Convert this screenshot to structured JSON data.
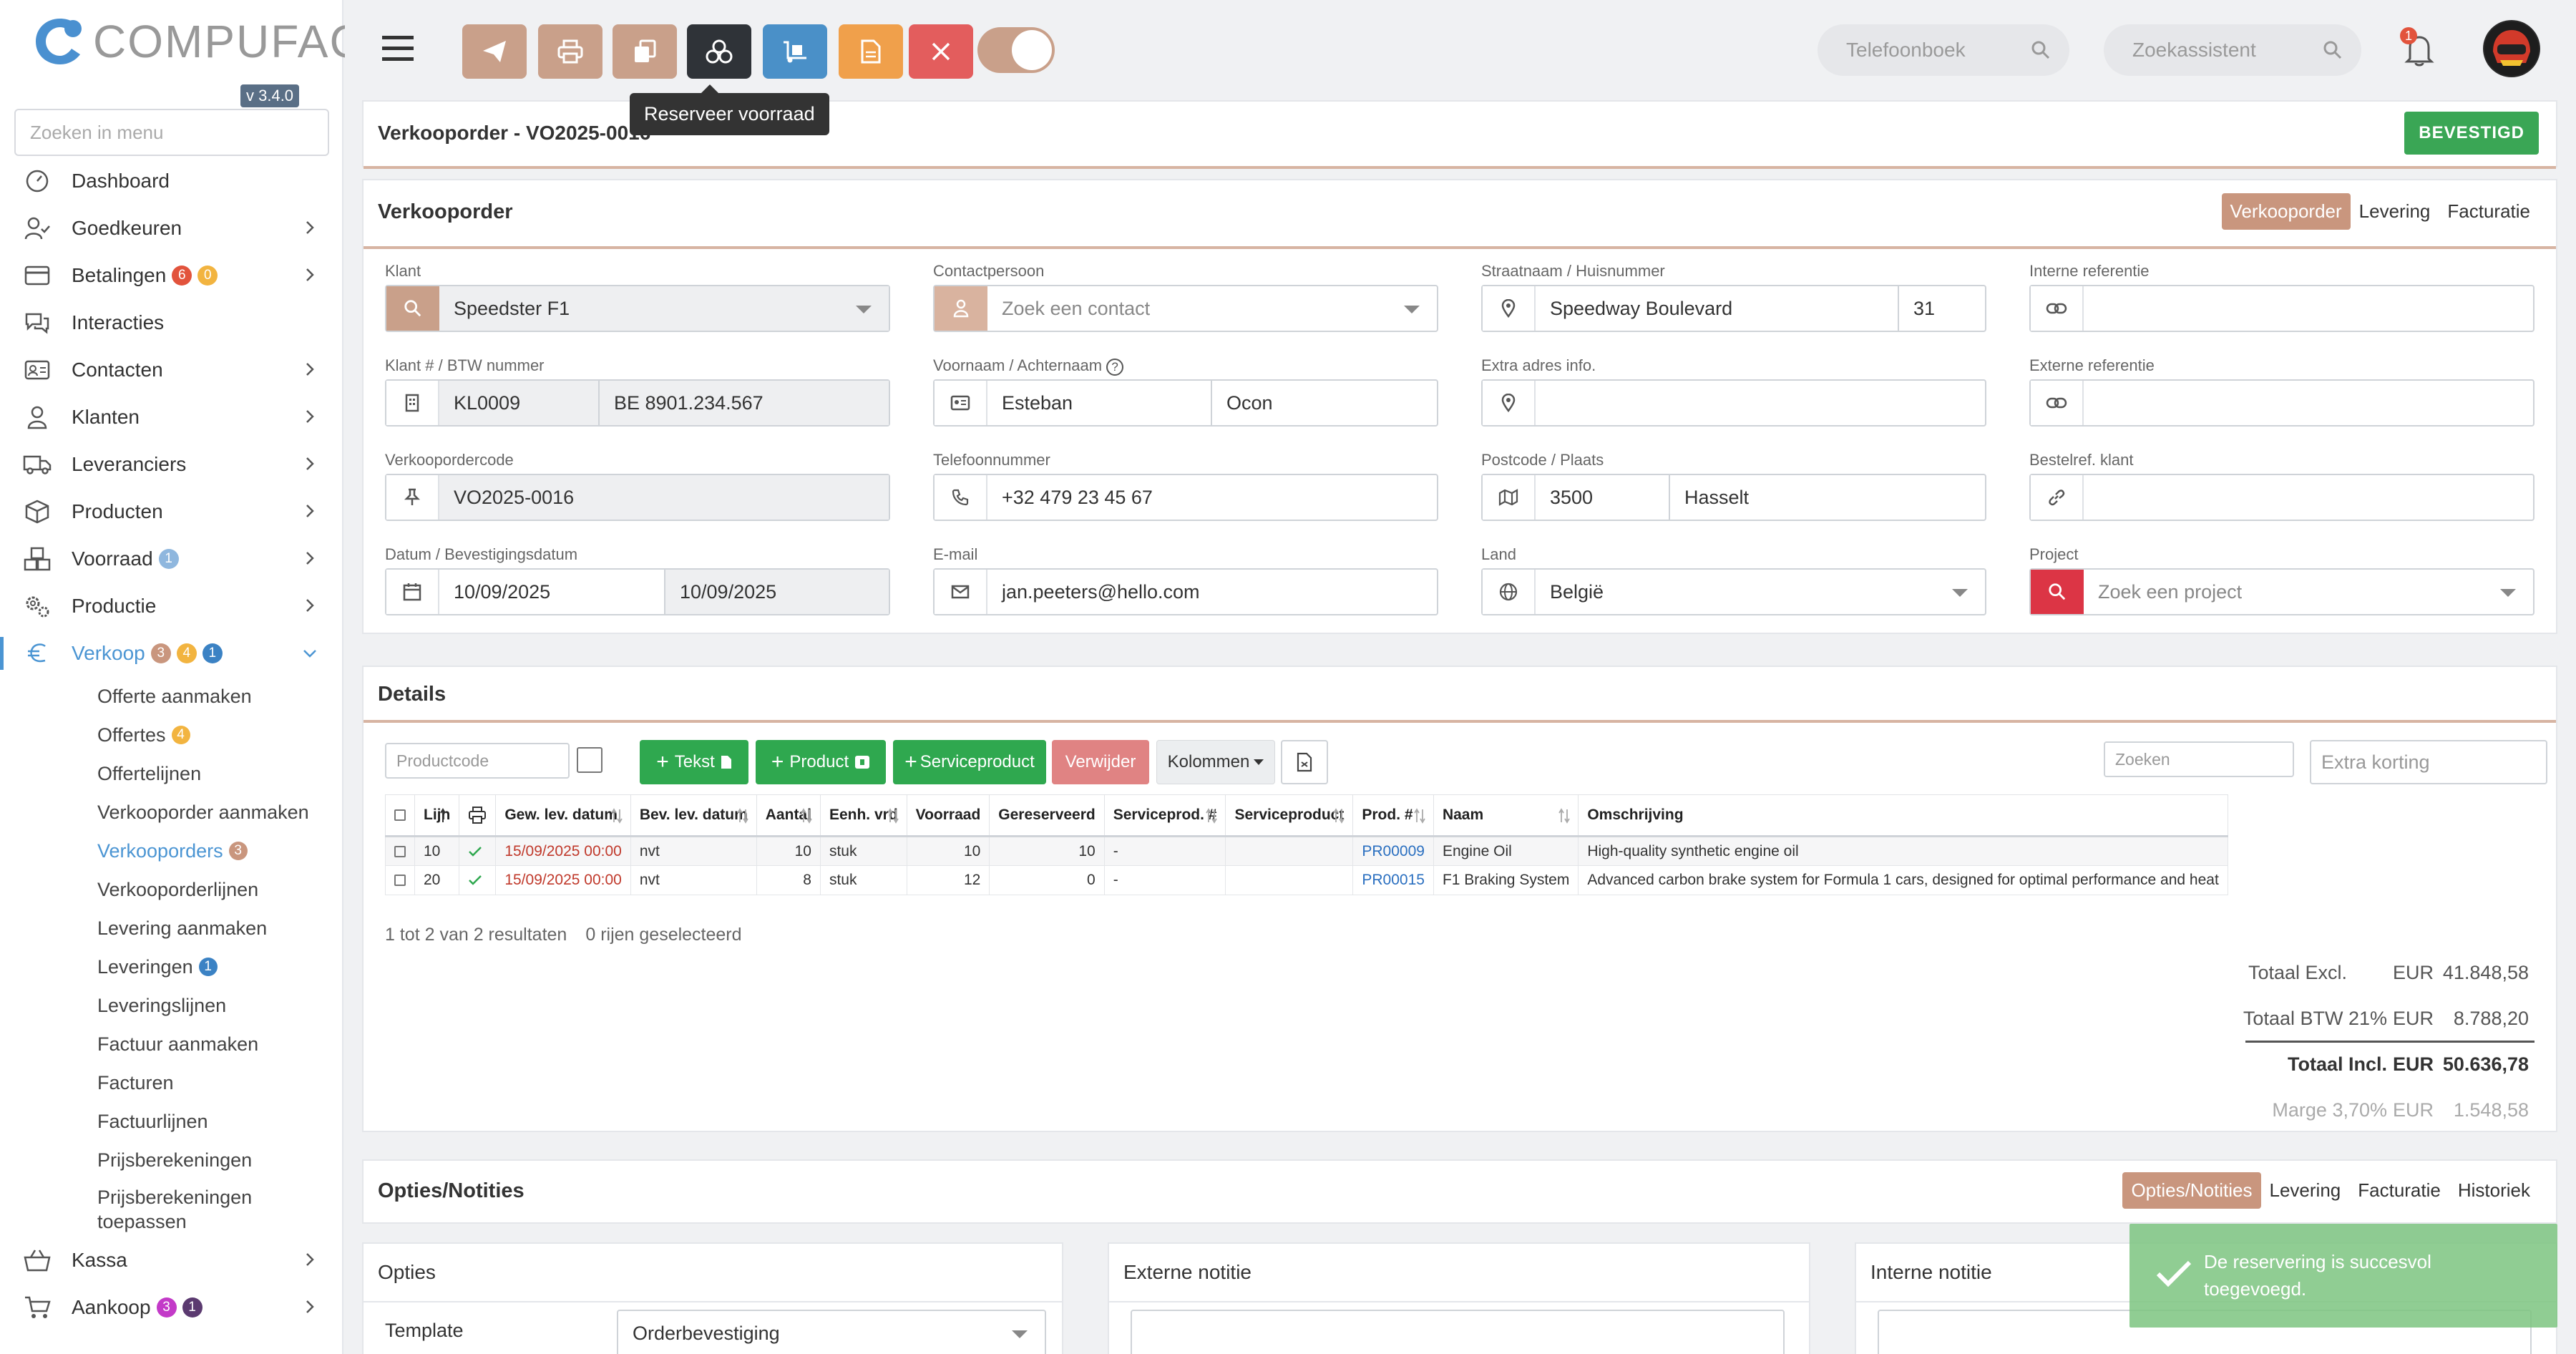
{
  "app": {
    "logo_text": "COMPUFACT",
    "version": "v 3.4.0",
    "menu_search_placeholder": "Zoeken in menu"
  },
  "sidebar": {
    "items": [
      {
        "label": "Dashboard",
        "icon": "dashboard-icon"
      },
      {
        "label": "Goedkeuren",
        "icon": "user-check-icon"
      },
      {
        "label": "Betalingen",
        "icon": "credit-card-icon",
        "badges": [
          "6",
          "0"
        ]
      },
      {
        "label": "Interacties",
        "icon": "chat-icon"
      },
      {
        "label": "Contacten",
        "icon": "contact-card-icon"
      },
      {
        "label": "Klanten",
        "icon": "user-icon"
      },
      {
        "label": "Leveranciers",
        "icon": "truck-icon"
      },
      {
        "label": "Producten",
        "icon": "box-icon"
      },
      {
        "label": "Voorraad",
        "icon": "boxes-icon",
        "badges": [
          "1"
        ]
      },
      {
        "label": "Productie",
        "icon": "gears-icon"
      },
      {
        "label": "Verkoop",
        "icon": "euro-icon",
        "badges": [
          "3",
          "4",
          "1"
        ]
      }
    ],
    "verkoop_sub": [
      {
        "label": "Offerte aanmaken"
      },
      {
        "label": "Offertes",
        "badge": "4"
      },
      {
        "label": "Offertelijnen"
      },
      {
        "label": "Verkooporder aanmaken"
      },
      {
        "label": "Verkooporders",
        "badge": "3"
      },
      {
        "label": "Verkooporderlijnen"
      },
      {
        "label": "Levering aanmaken"
      },
      {
        "label": "Leveringen",
        "badge": "1"
      },
      {
        "label": "Leveringslijnen"
      },
      {
        "label": "Factuur aanmaken"
      },
      {
        "label": "Facturen"
      },
      {
        "label": "Factuurlijnen"
      },
      {
        "label": "Prijsberekeningen"
      },
      {
        "label": "Prijsberekeningen toepassen"
      }
    ],
    "bottom": [
      {
        "label": "Kassa",
        "icon": "basket-icon"
      },
      {
        "label": "Aankoop",
        "icon": "cart-icon",
        "badges": [
          "3",
          "1"
        ]
      }
    ]
  },
  "topbar": {
    "tooltip": "Reserveer voorraad",
    "phonebook_placeholder": "Telefoonboek",
    "assistant_placeholder": "Zoekassistent",
    "notification_count": "1",
    "colors": {
      "send": "#c9a08a",
      "print": "#c9a08a",
      "copy": "#c9a08a",
      "reserve": "#2f3338",
      "deliver": "#4a90c8",
      "invoice": "#f0a04b",
      "delete": "#e35d5d"
    }
  },
  "order": {
    "title": "Verkooporder - VO2025-0016",
    "status": "BEVESTIGD",
    "section_title": "Verkooporder",
    "tabs": [
      "Verkooporder",
      "Levering",
      "Facturatie"
    ],
    "labels": {
      "klant": "Klant",
      "contactpersoon": "Contactpersoon",
      "straat": "Straatnaam / Huisnummer",
      "interne_ref": "Interne referentie",
      "klantnr": "Klant # / BTW nummer",
      "naam": "Voornaam / Achternaam",
      "extra_adres": "Extra adres info.",
      "externe_ref": "Externe referentie",
      "ordercode": "Verkoopordercode",
      "telefoon": "Telefoonnummer",
      "postcode": "Postcode / Plaats",
      "bestelref": "Bestelref. klant",
      "datum": "Datum / Bevestigingsdatum",
      "email": "E-mail",
      "land": "Land",
      "project": "Project"
    },
    "values": {
      "klant": "Speedster F1",
      "contact_placeholder": "Zoek een contact",
      "straat": "Speedway Boulevard",
      "huisnummer": "31",
      "interne_ref": "",
      "klantnr": "KL0009",
      "btw": "BE 8901.234.567",
      "voornaam": "Esteban",
      "achternaam": "Ocon",
      "extra_adres": "",
      "externe_ref": "",
      "ordercode": "VO2025-0016",
      "telefoon": "+32 479 23 45 67",
      "postcode": "3500",
      "plaats": "Hasselt",
      "bestelref": "",
      "datum": "10/09/2025",
      "bevestigingsdatum": "10/09/2025",
      "email": "jan.peeters@hello.com",
      "land": "België",
      "project_placeholder": "Zoek een project"
    }
  },
  "details": {
    "title": "Details",
    "productcode_placeholder": "Productcode",
    "buttons": {
      "tekst": "Tekst",
      "product": "Product",
      "serviceproduct": "Serviceproduct",
      "verwijder": "Verwijder",
      "kolommen": "Kolommen"
    },
    "search_placeholder": "Zoeken",
    "extra_korting_placeholder": "Extra korting",
    "columns": [
      "Lijn",
      "Gew. lev. datum",
      "Bev. lev. datum",
      "Aantal",
      "Eenh. vrd",
      "Voorraad",
      "Gereserveerd",
      "Serviceprod. #",
      "Serviceproduct",
      "Prod. #",
      "Naam",
      "Omschrijving"
    ],
    "rows": [
      {
        "lijn": "10",
        "gew": "15/09/2025 00:00",
        "bev": "nvt",
        "aantal": "10",
        "eenh": "stuk",
        "voorraad": "10",
        "gereserveerd": "10",
        "servnr": "-",
        "serv": "",
        "prod": "PR00009",
        "naam": "Engine Oil",
        "omschrijving": "High-quality synthetic engine oil"
      },
      {
        "lijn": "20",
        "gew": "15/09/2025 00:00",
        "bev": "nvt",
        "aantal": "8",
        "eenh": "stuk",
        "voorraad": "12",
        "gereserveerd": "0",
        "servnr": "-",
        "serv": "",
        "prod": "PR00015",
        "naam": "F1 Braking System",
        "omschrijving": "Advanced carbon brake system for Formula 1 cars, designed for optimal performance and heat"
      }
    ],
    "results_text": "1 tot 2 van 2 resultaten",
    "selected_text": "0 rijen geselecteerd",
    "totals": [
      {
        "label": "Totaal Excl.",
        "cur": "EUR",
        "value": "41.848,58"
      },
      {
        "label": "Totaal BTW 21%",
        "cur": "EUR",
        "value": "8.788,20"
      },
      {
        "label": "Totaal Incl.",
        "cur": "EUR",
        "value": "50.636,78"
      },
      {
        "label": "Marge 3,70%",
        "cur": "EUR",
        "value": "1.548,58"
      }
    ]
  },
  "options": {
    "title": "Opties/Notities",
    "tabs": [
      "Opties/Notities",
      "Levering",
      "Facturatie",
      "Historiek"
    ],
    "opties_title": "Opties",
    "template_label": "Template",
    "template_value": "Orderbevestiging",
    "externe_notitie": "Externe notitie",
    "interne_notitie": "Interne notitie"
  },
  "toast": {
    "message": "De reservering is succesvol toegevoegd."
  }
}
